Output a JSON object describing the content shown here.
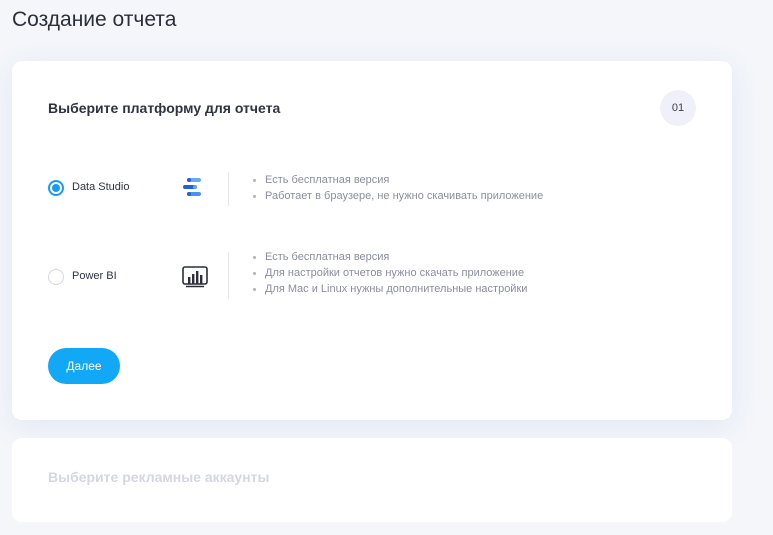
{
  "page": {
    "title": "Создание отчета"
  },
  "step1": {
    "title": "Выберите платформу для отчета",
    "number": "01",
    "options": [
      {
        "label": "Data Studio",
        "selected": true,
        "icon": "data-studio-icon",
        "features": [
          "Есть бесплатная версия",
          "Работает в браузере, не нужно скачивать приложение"
        ]
      },
      {
        "label": "Power BI",
        "selected": false,
        "icon": "power-bi-icon",
        "features": [
          "Есть бесплатная версия",
          "Для настройки отчетов нужно скачать приложение",
          "Для Mac и Linux нужны дополнительные настройки"
        ]
      }
    ],
    "next_label": "Далее"
  },
  "step2": {
    "title": "Выберите рекламные аккаунты"
  },
  "colors": {
    "accent": "#12a8f5",
    "radio": "#1a9bf0",
    "data_studio_dark": "#1f63d6",
    "data_studio_light": "#6aa8f7"
  }
}
